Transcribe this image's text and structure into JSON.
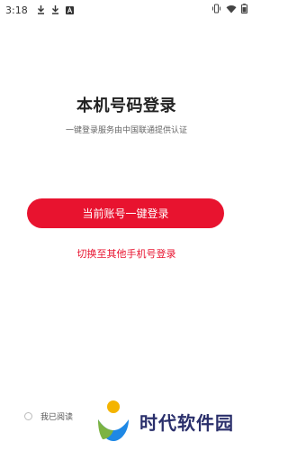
{
  "status_bar": {
    "time": "3:18",
    "icons_left": [
      "download-icon",
      "download-icon",
      "font-a-icon"
    ],
    "icons_right": [
      "vibrate-icon",
      "wifi-icon",
      "battery-icon"
    ]
  },
  "login": {
    "title": "本机号码登录",
    "subtitle": "一键登录服务由中国联通提供认证",
    "primary_button_label": "当前账号一键登录",
    "switch_link_label": "切换至其他手机号登录"
  },
  "agreement": {
    "text": "我已阅读"
  },
  "watermark": {
    "text": "时代软件园"
  },
  "colors": {
    "accent": "#e8132f",
    "watermark_text": "#2a2f6b"
  }
}
